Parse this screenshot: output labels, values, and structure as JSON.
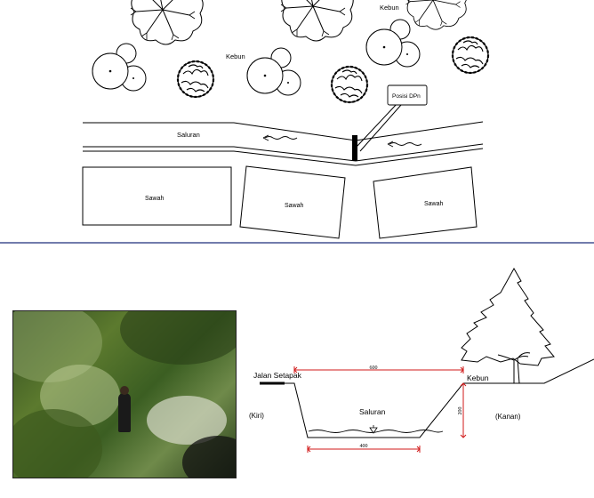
{
  "plan": {
    "kebun_label_1": "Kebun",
    "kebun_label_2": "Kebun",
    "saluran_label": "Saluran",
    "posisi_label": "Posisi DPn",
    "sawah_labels": [
      "Sawah",
      "Sawah",
      "Sawah"
    ]
  },
  "section": {
    "jalan_label": "Jalan Setapak",
    "kebun_label": "Kebun",
    "saluran_label": "Saluran",
    "kiri_label": "(Kiri)",
    "kanan_label": "(Kanan)",
    "top_width": "600",
    "bottom_width": "400",
    "depth": "200"
  },
  "colors": {
    "divider": "#1f2f7a",
    "dimension": "#d11a1a",
    "line": "#000000"
  }
}
